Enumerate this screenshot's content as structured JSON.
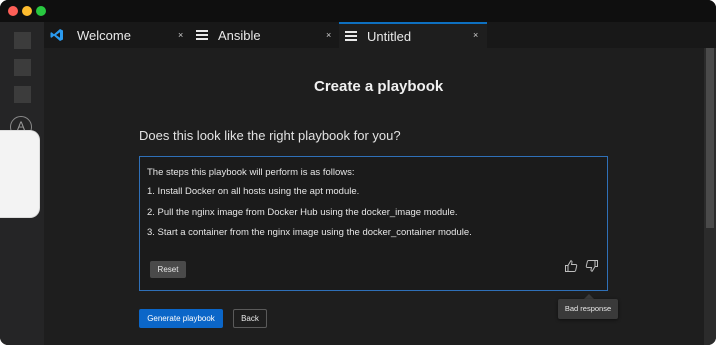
{
  "tabs": [
    {
      "label": "Welcome",
      "icon": "vscode-logo-icon",
      "close": "×",
      "active": false
    },
    {
      "label": "Ansible",
      "icon": "menu-icon",
      "close": "×",
      "active": false
    },
    {
      "label": "Untitled",
      "icon": "menu-icon",
      "close": "×",
      "active": true
    }
  ],
  "activity_bar": {
    "ansible_icon_letter": "A"
  },
  "main": {
    "title": "Create a playbook",
    "question": "Does this look like the right playbook for you?",
    "steps_intro": "The steps this playbook will perform is as follows:",
    "steps": [
      "1.  Install Docker on all hosts using the apt module.",
      "2. Pull the nginx image from Docker Hub using the docker_image module.",
      "3. Start a container from the nginx image using the docker_container module."
    ],
    "reset_label": "Reset",
    "tooltip": "Bad response",
    "generate_label": "Generate playbook",
    "back_label": "Back"
  },
  "colors": {
    "accent_blue": "#0b66c8",
    "box_border": "#2f70b8",
    "background": "#1e1e1e"
  }
}
